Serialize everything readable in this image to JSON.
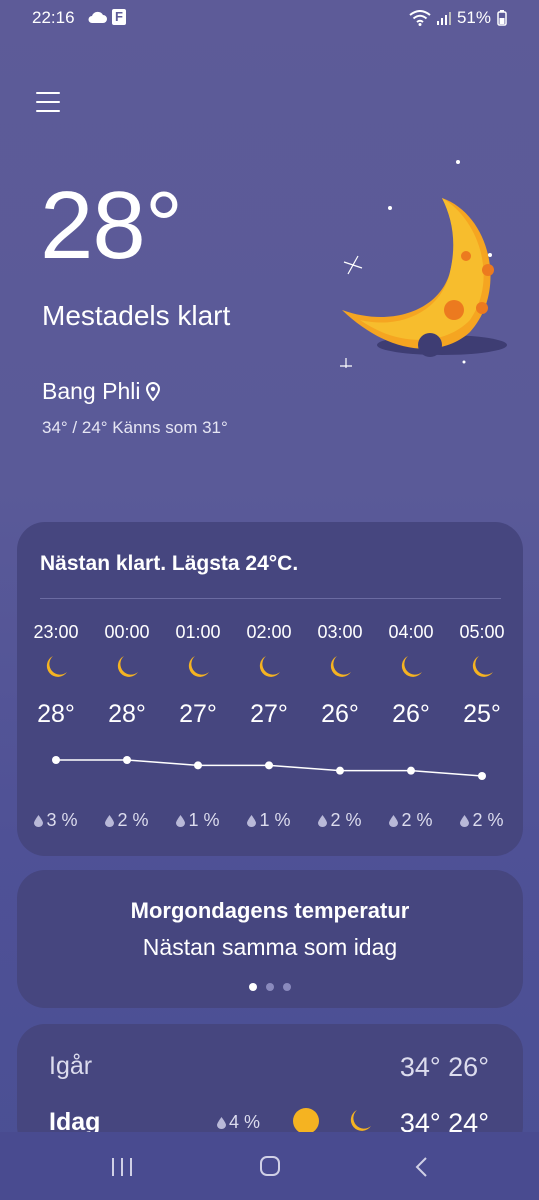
{
  "status": {
    "time": "22:16",
    "battery": "51%"
  },
  "current": {
    "temperature": "28°",
    "condition": "Mestadels klart",
    "location": "Bang Phli",
    "hilo_feels": "34° / 24° Känns som 31°"
  },
  "hourly": {
    "summary": "Nästan klart. Lägsta 24°C.",
    "items": [
      {
        "time": "23:00",
        "temp": "28°",
        "precip": "3 %",
        "value": 28
      },
      {
        "time": "00:00",
        "temp": "28°",
        "precip": "2 %",
        "value": 28
      },
      {
        "time": "01:00",
        "temp": "27°",
        "precip": "1 %",
        "value": 27
      },
      {
        "time": "02:00",
        "temp": "27°",
        "precip": "1 %",
        "value": 27
      },
      {
        "time": "03:00",
        "temp": "26°",
        "precip": "2 %",
        "value": 26
      },
      {
        "time": "04:00",
        "temp": "26°",
        "precip": "2 %",
        "value": 26
      },
      {
        "time": "05:00",
        "temp": "25°",
        "precip": "2 %",
        "value": 25
      }
    ]
  },
  "tomorrow": {
    "title": "Morgondagens temperatur",
    "subtitle": "Nästan samma som idag",
    "page_index": 0,
    "page_count": 3
  },
  "daily": {
    "yesterday": {
      "label": "Igår",
      "temps": "34° 26°"
    },
    "today": {
      "label": "Idag",
      "precip": "4 %",
      "temps": "34° 24°"
    }
  },
  "colors": {
    "background": "#5d5b98",
    "card": "#46467f",
    "sun": "#f5b321",
    "moon": "#f5b321"
  },
  "icons": [
    "menu-icon",
    "location-pin-icon",
    "moon-icon",
    "sun-icon",
    "raindrop-icon",
    "wifi-icon",
    "signal-icon",
    "battery-icon"
  ]
}
